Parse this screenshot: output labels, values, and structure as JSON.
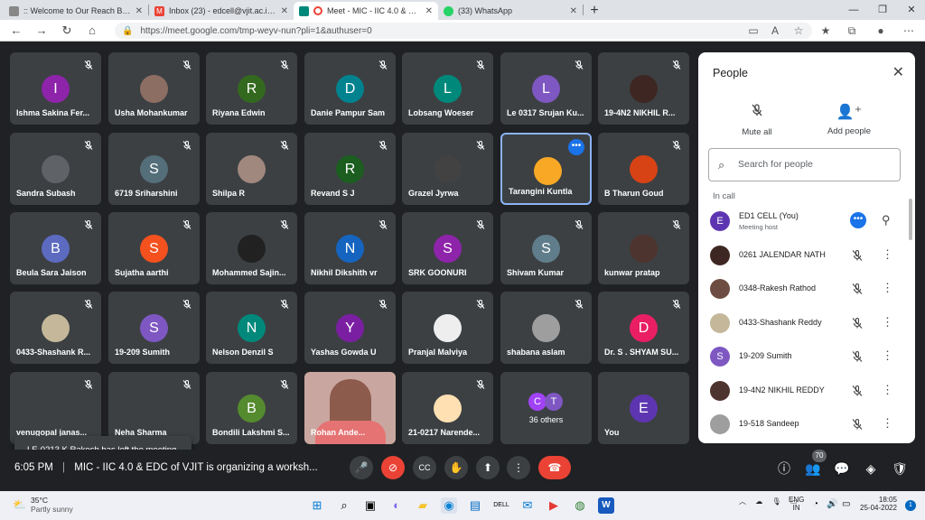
{
  "browser": {
    "tabs": [
      {
        "title": ":: Welcome to Our Reach Broadb...",
        "favicon_color": "#888888",
        "active": false
      },
      {
        "title": "Inbox (23) - edcell@vjit.ac.in - Vi",
        "favicon_color": "#ea4335",
        "active": false
      },
      {
        "title": "Meet - MIC - IIC 4.0 & EDC",
        "favicon_color": "#00897b",
        "active": true
      },
      {
        "title": "(33) WhatsApp",
        "favicon_color": "#25d366",
        "active": false
      }
    ],
    "url": "https://meet.google.com/tmp-weyv-nun?pli=1&authuser=0"
  },
  "tiles": [
    {
      "name": "Ishma Sakina Fer...",
      "initial": "I",
      "color": "#8e24aa"
    },
    {
      "name": "Usha Mohankumar",
      "initial": "",
      "color": "#8d6e63"
    },
    {
      "name": "Riyana Edwin",
      "initial": "R",
      "color": "#33691e"
    },
    {
      "name": "Danie Pampur Sam",
      "initial": "D",
      "color": "#00838f"
    },
    {
      "name": "Lobsang Woeser",
      "initial": "L",
      "color": "#00897b"
    },
    {
      "name": "Le 0317 Srujan Ku...",
      "initial": "L",
      "color": "#7e57c2"
    },
    {
      "name": "19-4N2 NIKHIL R...",
      "initial": "",
      "color": "#3e2723"
    },
    {
      "name": "Sandra Subash",
      "initial": "",
      "color": "#5f6368"
    },
    {
      "name": "6719 Sriharshini",
      "initial": "S",
      "color": "#546e7a"
    },
    {
      "name": "Shilpa R",
      "initial": "",
      "color": "#a1887f"
    },
    {
      "name": "Revand S J",
      "initial": "R",
      "color": "#1b5e20"
    },
    {
      "name": "Grazel Jyrwa",
      "initial": "",
      "color": "#424242"
    },
    {
      "name": "Tarangini Kuntla",
      "initial": "",
      "color": "#f9a825"
    },
    {
      "name": "B Tharun Goud",
      "initial": "",
      "color": "#d84315"
    },
    {
      "name": "Beula Sara Jaison",
      "initial": "B",
      "color": "#5c6bc0"
    },
    {
      "name": "Sujatha aarthi",
      "initial": "S",
      "color": "#f4511e"
    },
    {
      "name": "Mohammed Sajin...",
      "initial": "",
      "color": "#212121"
    },
    {
      "name": "Nikhil Dikshith vr",
      "initial": "N",
      "color": "#1565c0"
    },
    {
      "name": "SRK GOONURI",
      "initial": "S",
      "color": "#8e24aa"
    },
    {
      "name": "Shivam Kumar",
      "initial": "S",
      "color": "#607d8b"
    },
    {
      "name": "kunwar pratap",
      "initial": "",
      "color": "#4e342e"
    },
    {
      "name": "0433-Shashank R...",
      "initial": "",
      "color": "#c5b89a"
    },
    {
      "name": "19-209 Sumith",
      "initial": "S",
      "color": "#7e57c2"
    },
    {
      "name": "Nelson Denzil S",
      "initial": "N",
      "color": "#00897b"
    },
    {
      "name": "Yashas Gowda U",
      "initial": "Y",
      "color": "#7b1fa2"
    },
    {
      "name": "Pranjal Malviya",
      "initial": "",
      "color": "#eeeeee"
    },
    {
      "name": "shabana aslam",
      "initial": "",
      "color": "#9e9e9e"
    },
    {
      "name": "Dr. S . SHYAM SU...",
      "initial": "D",
      "color": "#e91e63"
    },
    {
      "name": "venugopal janas...",
      "initial": "",
      "color": "#3c4043"
    },
    {
      "name": "Neha Sharma",
      "initial": "",
      "color": "#3c4043"
    },
    {
      "name": "Bondili Lakshmi S...",
      "initial": "B",
      "color": "#558b2f"
    },
    {
      "name": "Rohan Ande...",
      "initial": "",
      "color": "#c9a7a0"
    },
    {
      "name": "21-0217 Narende...",
      "initial": "",
      "color": "#ffe0b2"
    },
    {
      "name": "36 others",
      "initial": "",
      "color": "#3c4043"
    },
    {
      "name": "You",
      "initial": "E",
      "color": "#5e35b1"
    }
  ],
  "others_avatars": [
    {
      "initial": "C",
      "color": "#a142f4"
    },
    {
      "initial": "T",
      "color": "#7e57c2"
    }
  ],
  "toast": "LE-0213 K Rakesh has left the meeting",
  "meeting": {
    "time": "6:05 PM",
    "separator": "|",
    "title": "MIC - IIC 4.0 & EDC of VJIT is organizing a worksh..."
  },
  "participant_count": "70",
  "people_panel": {
    "title": "People",
    "mute_all": "Mute all",
    "add_people": "Add people",
    "search_placeholder": "Search for people",
    "section": "In call",
    "participants": [
      {
        "name": "ED1 CELL (You)",
        "sub": "Meeting host",
        "initial": "E",
        "color": "#5e35b1",
        "host": true
      },
      {
        "name": "0261 JALENDAR NATH",
        "sub": "",
        "initial": "",
        "color": "#3e2723",
        "host": false
      },
      {
        "name": "0348-Rakesh Rathod",
        "sub": "",
        "initial": "",
        "color": "#6d4c41",
        "host": false
      },
      {
        "name": "0433-Shashank Reddy",
        "sub": "",
        "initial": "",
        "color": "#c5b89a",
        "host": false
      },
      {
        "name": "19-209 Sumith",
        "sub": "",
        "initial": "S",
        "color": "#7e57c2",
        "host": false
      },
      {
        "name": "19-4N2 NIKHIL REDDY",
        "sub": "",
        "initial": "",
        "color": "#4e342e",
        "host": false
      },
      {
        "name": "19-518 Sandeep",
        "sub": "",
        "initial": "",
        "color": "#9e9e9e",
        "host": false
      }
    ]
  },
  "taskbar": {
    "temp": "35°C",
    "weather": "Partly sunny",
    "lang1": "ENG",
    "lang2": "IN",
    "time": "18:05",
    "date": "25-04-2022"
  }
}
